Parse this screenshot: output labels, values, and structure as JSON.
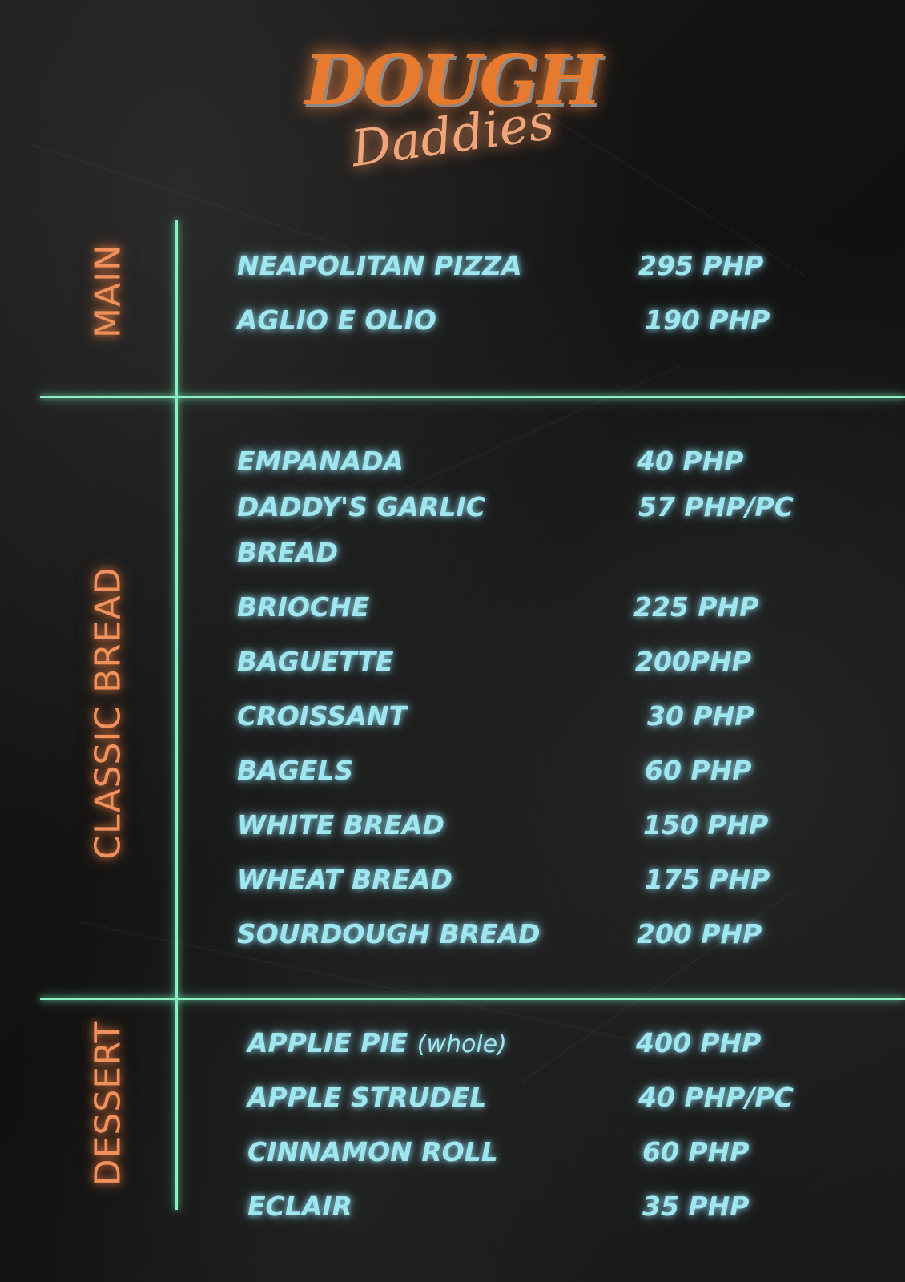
{
  "brand": {
    "logo_top": "DOUGH",
    "logo_bottom": "Daddies"
  },
  "colors": {
    "background": "#151515",
    "accent_orange": "#f0905a",
    "item_cyan": "#9fe6f0",
    "divider_green": "#8ef0c0"
  },
  "sections": {
    "main": {
      "label": "MAIN",
      "items": [
        {
          "name": "NEAPOLITAN PIZZA",
          "price": "295 PHP"
        },
        {
          "name": "AGLIO E OLIO",
          "price": "190 PHP"
        }
      ]
    },
    "classic_bread": {
      "label": "CLASSIC BREAD",
      "items": [
        {
          "name": "EMPANADA",
          "price": "40 PHP"
        },
        {
          "name": "DADDY'S GARLIC",
          "price": "57 PHP/PC"
        },
        {
          "name": "BREAD"
        },
        {
          "name": "BRIOCHE",
          "price": "225 PHP"
        },
        {
          "name": "BAGUETTE",
          "price": "200PHP"
        },
        {
          "name": "CROISSANT",
          "price": "30 PHP"
        },
        {
          "name": "BAGELS",
          "price": "60 PHP"
        },
        {
          "name": "WHITE BREAD",
          "price": "150 PHP"
        },
        {
          "name": "WHEAT BREAD",
          "price": "175 PHP"
        },
        {
          "name": "SOURDOUGH BREAD",
          "price": "200 PHP"
        }
      ]
    },
    "dessert": {
      "label": "DESSERT",
      "items": [
        {
          "name": "APPLIE PIE",
          "note": "(whole)",
          "price": "400 PHP"
        },
        {
          "name": "APPLE STRUDEL",
          "price": "40 PHP/PC"
        },
        {
          "name": "CINNAMON ROLL",
          "price": "60 PHP"
        },
        {
          "name": "ECLAIR",
          "price": "35 PHP"
        }
      ]
    }
  }
}
